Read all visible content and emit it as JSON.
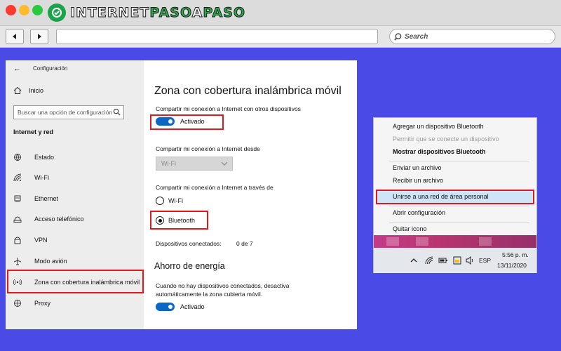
{
  "browser": {
    "logo_text_part1": "INTERNET",
    "logo_text_part2": "PASO",
    "logo_text_part3": "A",
    "logo_text_part4": "PASO",
    "search_placeholder": "Search"
  },
  "settings": {
    "window_title": "Configuración",
    "home_label": "Inicio",
    "search_placeholder": "Buscar una opción de configuración",
    "section_heading": "Internet y red",
    "nav_items": [
      {
        "label": "Estado",
        "icon": "globe-icon"
      },
      {
        "label": "Wi-Fi",
        "icon": "wifi-icon"
      },
      {
        "label": "Ethernet",
        "icon": "ethernet-icon"
      },
      {
        "label": "Acceso telefónico",
        "icon": "dialup-icon"
      },
      {
        "label": "VPN",
        "icon": "vpn-icon"
      },
      {
        "label": "Modo avión",
        "icon": "airplane-icon"
      },
      {
        "label": "Zona con cobertura inalámbrica móvil",
        "icon": "hotspot-icon"
      },
      {
        "label": "Proxy",
        "icon": "proxy-icon"
      }
    ],
    "selected_nav": "Zona con cobertura inalámbrica móvil",
    "main": {
      "title": "Zona con cobertura inalámbrica móvil",
      "share_label": "Compartir mi conexión a Internet con otros dispositivos",
      "share_toggle_state": "Activado",
      "share_from_label": "Compartir mi conexión a Internet desde",
      "share_from_value": "Wi-Fi",
      "share_via_label": "Compartir mi conexión a Internet a través de",
      "radio_options": [
        "Wi-Fi",
        "Bluetooth"
      ],
      "radio_selected": "Bluetooth",
      "connected_label": "Dispositivos conectados:",
      "connected_value": "0 de 7",
      "energy_heading": "Ahorro de energía",
      "energy_desc_line1": "Cuando no hay dispositivos conectados, desactiva",
      "energy_desc_line2": "automáticamente la zona cubierta móvil.",
      "energy_toggle_state": "Activado"
    }
  },
  "context_menu": {
    "items": [
      {
        "label": "Agregar un dispositivo Bluetooth",
        "style": "normal"
      },
      {
        "label": "Permitir que se conecte un dispositivo",
        "style": "disabled"
      },
      {
        "label": "Mostrar dispositivos Bluetooth",
        "style": "bold"
      },
      {
        "label": "Enviar un archivo",
        "style": "normal"
      },
      {
        "label": "Recibir un archivo",
        "style": "normal"
      },
      {
        "label": "Unirse a una red de área personal",
        "style": "highlighted"
      },
      {
        "label": "Abrir configuración",
        "style": "normal"
      },
      {
        "label": "Quitar icono",
        "style": "normal"
      }
    ]
  },
  "taskbar": {
    "language": "ESP",
    "time": "5:56 p. m.",
    "date": "13/11/2020"
  },
  "colors": {
    "page_background": "#4a4ae6",
    "accent_blue": "#0a67c5",
    "highlight_red": "#e0191f",
    "logo_green": "#2aa84a"
  }
}
